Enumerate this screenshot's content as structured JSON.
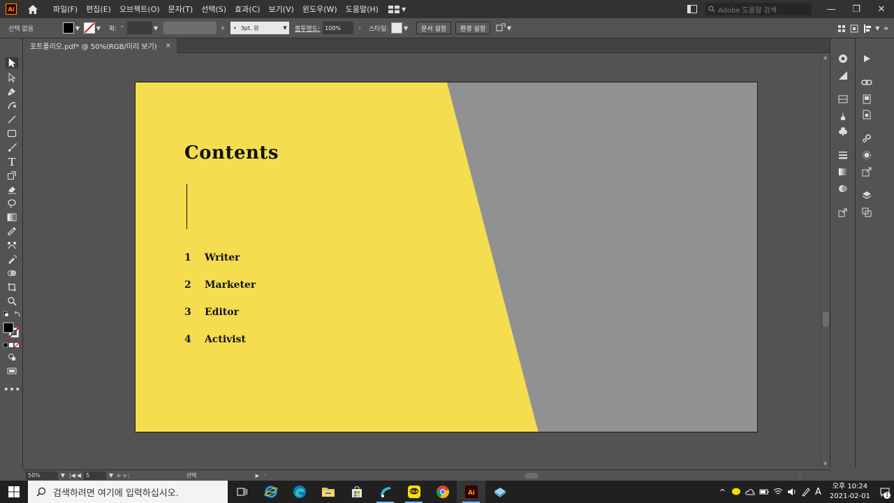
{
  "app": {
    "logo_text": "Ai",
    "menu": [
      "파일(F)",
      "편집(E)",
      "오브젝트(O)",
      "문자(T)",
      "선택(S)",
      "효과(C)",
      "보기(V)",
      "윈도우(W)",
      "도움말(H)"
    ],
    "search_placeholder": "Adobe 도움말 검색"
  },
  "control_bar": {
    "selection_label": "선택 없음",
    "stroke_label": "획:",
    "brush_label": "3pt. 원",
    "opacity_label": "불투명도:",
    "opacity_value": "100%",
    "style_label": "스타일:",
    "doc_setup_button": "문서 설정",
    "preferences_button": "환경 설정"
  },
  "document": {
    "tab_title": "포트폴리오.pdf* @ 50%(RGB/미리 보기)",
    "tab_close": "×"
  },
  "artboard": {
    "title": "Contents",
    "items": [
      {
        "num": "1",
        "label": "Writer"
      },
      {
        "num": "2",
        "label": "Marketer"
      },
      {
        "num": "3",
        "label": "Editor"
      },
      {
        "num": "4",
        "label": "Activist"
      }
    ],
    "colors": {
      "yellow": "#f5dd50",
      "gray": "#919193"
    }
  },
  "status_bar": {
    "zoom": "50%",
    "page": "5",
    "tool_name": "선택"
  },
  "taskbar": {
    "search_placeholder": "검색하려면 여기에 입력하십시오.",
    "time_period": "오후 10:24",
    "date": "2021-02-01",
    "ime_label": "A",
    "notification_count": "1"
  }
}
